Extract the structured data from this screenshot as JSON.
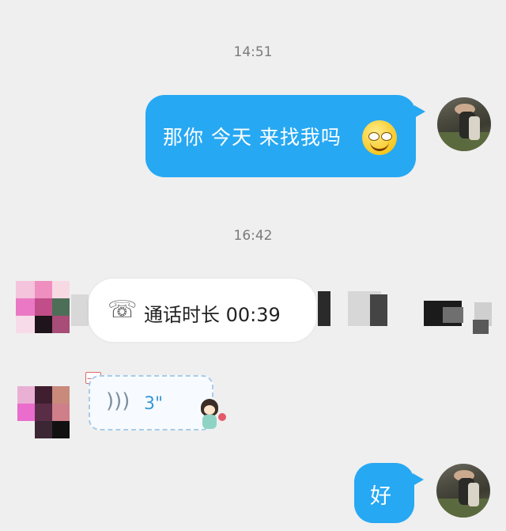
{
  "messages": [
    {
      "type": "timestamp",
      "text": "14:51"
    },
    {
      "type": "outgoing_text",
      "text": "那你 今天 来找我吗",
      "emoji": "grin-emoji"
    },
    {
      "type": "timestamp",
      "text": "16:42"
    },
    {
      "type": "call_record",
      "icon": "phone-icon",
      "text": "通话时长 00:39"
    },
    {
      "type": "voice_message",
      "icon": "voice-waves-icon",
      "duration": "3\""
    },
    {
      "type": "outgoing_text",
      "text": "好"
    }
  ],
  "colors": {
    "background": "#efefef",
    "outgoing_bubble": "#27a8f3",
    "voice_duration": "#3a98d8"
  }
}
